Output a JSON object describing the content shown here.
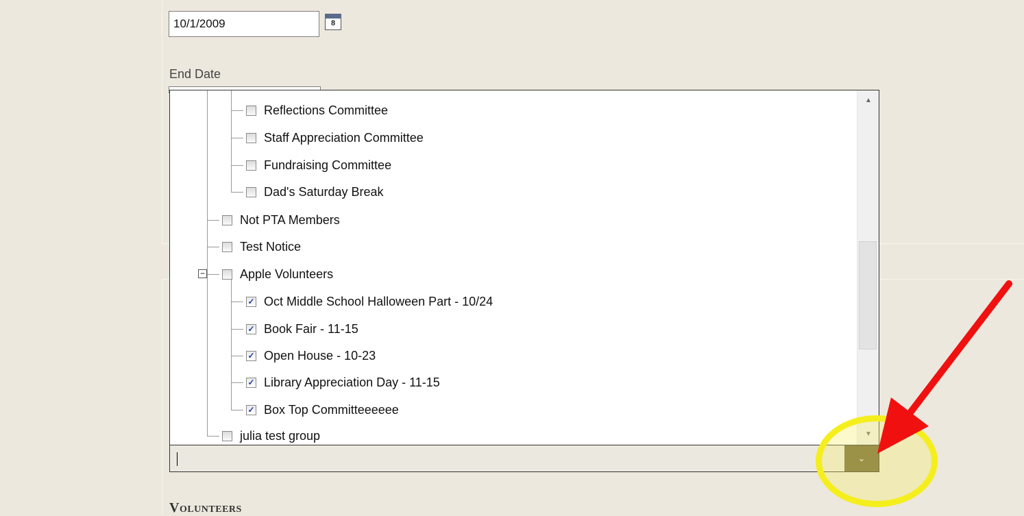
{
  "start_date": {
    "value": "10/1/2009",
    "calendar_icon": "calendar-icon",
    "calendar_text": "8"
  },
  "end_date": {
    "label": "End Date"
  },
  "tree": {
    "items": [
      {
        "label": "Reflections Committee",
        "checked": false
      },
      {
        "label": "Staff Appreciation Committee",
        "checked": false
      },
      {
        "label": "Fundraising Committee",
        "checked": false
      },
      {
        "label": "Dad's Saturday Break",
        "checked": false
      },
      {
        "label": "Not PTA Members",
        "checked": false
      },
      {
        "label": "Test Notice",
        "checked": false
      },
      {
        "label": "Apple Volunteers",
        "checked": false,
        "expander": "−"
      },
      {
        "label": "Oct Middle School Halloween Part - 10/24",
        "checked": true
      },
      {
        "label": "Book Fair - 11-15",
        "checked": true
      },
      {
        "label": "Open House - 10-23",
        "checked": true
      },
      {
        "label": "Library Appreciation Day - 11-15",
        "checked": true
      },
      {
        "label": "Box Top Committeeeeee",
        "checked": true
      },
      {
        "label": "julia test group",
        "checked": false
      }
    ],
    "check_glyph": "✓",
    "scroll_up": "▲",
    "scroll_down": "▼"
  },
  "combo": {
    "value": "",
    "button_glyph": "⌄"
  },
  "section_title": "Volunteers",
  "colors": {
    "arrow": "#f01010",
    "highlight": "#f5ee1d",
    "combo_button": "#6b6235"
  }
}
